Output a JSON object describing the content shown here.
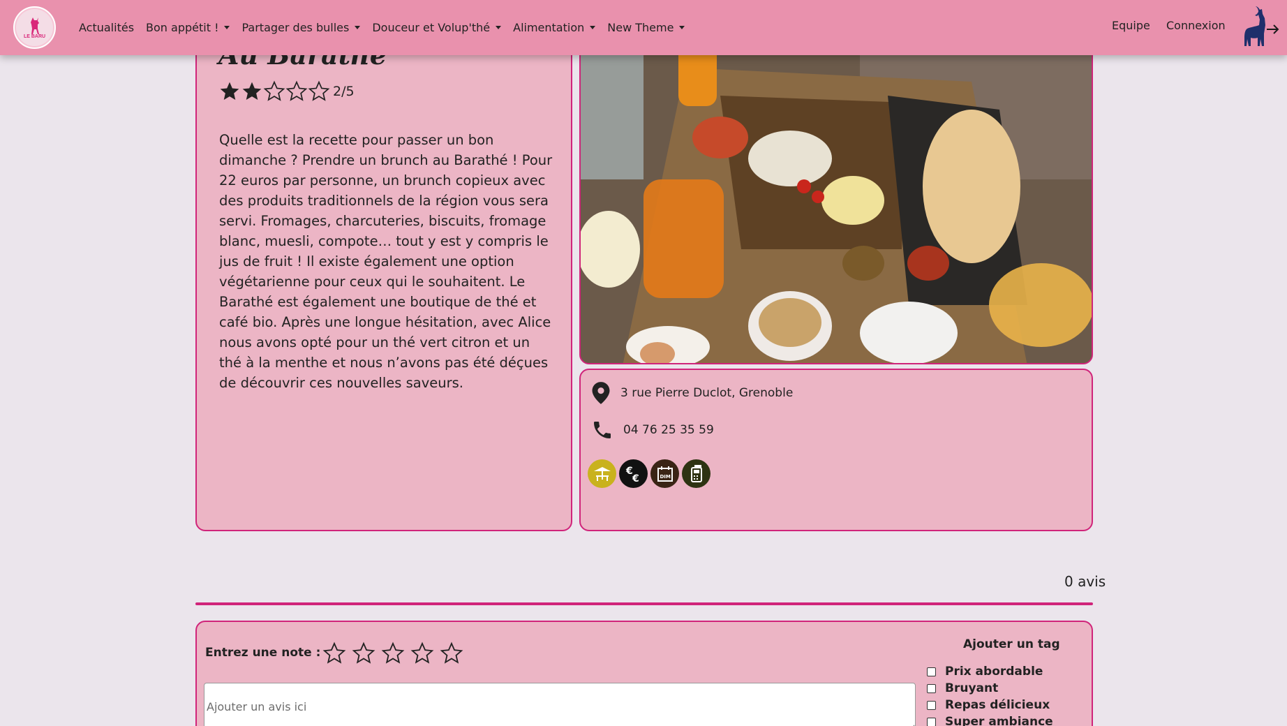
{
  "nav": {
    "logo_text": "LE BARU",
    "links": [
      {
        "label": "Actualités",
        "dropdown": false
      },
      {
        "label": "Bon appétit !",
        "dropdown": true
      },
      {
        "label": "Partager des bulles",
        "dropdown": true
      },
      {
        "label": "Douceur et Volup'thé",
        "dropdown": true
      },
      {
        "label": "Alimentation",
        "dropdown": true
      },
      {
        "label": "New Theme",
        "dropdown": true
      }
    ],
    "equipe": "Equipe",
    "connexion": "Connexion"
  },
  "restaurant": {
    "title": "Au Barathé",
    "rating": 2,
    "rating_max": 5,
    "rating_text": "2/5",
    "description": "Quelle est la recette pour passer un bon dimanche ? Prendre un brunch au Barathé ! Pour 22 euros par personne, un brunch copieux avec des produits traditionnels de la région vous sera servi. Fromages, charcuteries, biscuits, fromage blanc, muesli, compote… tout y est y compris le jus de fruit ! Il existe également une option végétarienne pour ceux qui le souhaitent. Le Barathé est également une boutique de thé et café bio. Après une longue hésitation, avec Alice nous avons opté pour un thé vert citron et un thé à la menthe et nous n’avons pas été déçues de découvrir ces nouvelles saveurs.",
    "address": "3 rue Pierre Duclot, Grenoble",
    "phone": "04 76 25 35 59",
    "badges": [
      {
        "icon": "terrace-icon",
        "color": "#c9b21d"
      },
      {
        "icon": "euro-icon",
        "color": "#111111"
      },
      {
        "icon": "sunday-calendar-icon",
        "color": "#3a2415",
        "text": "DIM"
      },
      {
        "icon": "terminal-icon",
        "color": "#2e3312"
      }
    ]
  },
  "reviews": {
    "count_text": "0 avis",
    "note_label": "Entrez une note :",
    "input_placeholder": "Ajouter un avis ici",
    "tag_title": "Ajouter un tag",
    "tags": [
      "Prix abordable",
      "Bruyant",
      "Repas délicieux",
      "Super ambiance"
    ]
  },
  "colors": {
    "navbar": "#e991ad",
    "card": "#ecb5c5",
    "accent": "#d0247a",
    "background": "#ebe5ec"
  }
}
